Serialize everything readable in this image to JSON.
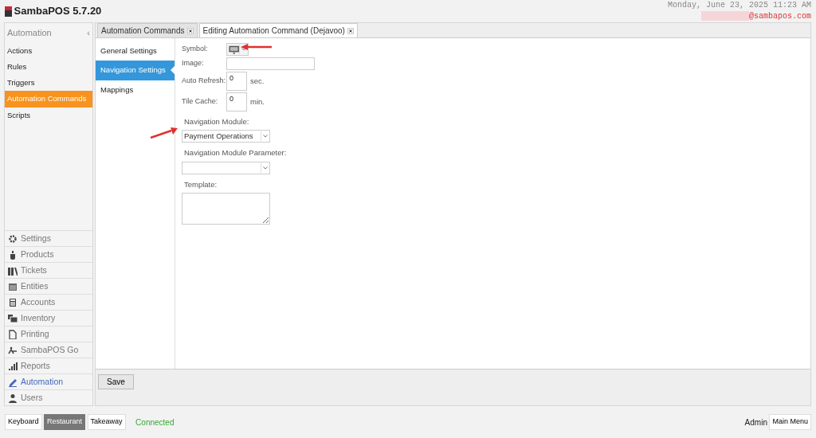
{
  "app": {
    "title": "SambaPOS 5.7.20"
  },
  "header": {
    "datetime": "Monday, June 23, 2025 11:23 AM",
    "email": "@sambapos.com"
  },
  "sidebar": {
    "section_title": "Automation",
    "collapse": "‹",
    "items": [
      {
        "label": "Actions",
        "selected": false
      },
      {
        "label": "Rules",
        "selected": false
      },
      {
        "label": "Triggers",
        "selected": false
      },
      {
        "label": "Automation Commands",
        "selected": true
      },
      {
        "label": "Scripts",
        "selected": false
      }
    ],
    "modules": [
      {
        "label": "Settings",
        "selected": false
      },
      {
        "label": "Products",
        "selected": false
      },
      {
        "label": "Tickets",
        "selected": false
      },
      {
        "label": "Entities",
        "selected": false
      },
      {
        "label": "Accounts",
        "selected": false
      },
      {
        "label": "Inventory",
        "selected": false
      },
      {
        "label": "Printing",
        "selected": false
      },
      {
        "label": "SambaPOS Go",
        "selected": false
      },
      {
        "label": "Reports",
        "selected": false
      },
      {
        "label": "Automation",
        "selected": true
      },
      {
        "label": "Users",
        "selected": false
      }
    ]
  },
  "tabs": [
    {
      "label": "Automation Commands",
      "selected": false
    },
    {
      "label": "Editing Automation Command (Dejavoo)",
      "selected": true
    }
  ],
  "settings_tabs": [
    {
      "label": "General Settings",
      "selected": false
    },
    {
      "label": "Navigation Settings",
      "selected": true
    },
    {
      "label": "Mappings",
      "selected": false
    }
  ],
  "form": {
    "fields": [
      {
        "kind": "symbol",
        "label": "Symbol:"
      },
      {
        "kind": "text",
        "label": "Image:"
      },
      {
        "kind": "number",
        "label": "Auto Refresh:",
        "value": "0",
        "unit": "sec."
      },
      {
        "kind": "number",
        "label": "Tile Cache:",
        "value": "0",
        "unit": "min."
      },
      {
        "kind": "select",
        "label": "Navigation Module:",
        "value": "Payment Operations"
      },
      {
        "kind": "select",
        "label": "Navigation Module Parameter:"
      },
      {
        "kind": "textarea",
        "label": "Template:"
      }
    ]
  },
  "save_button": "Save",
  "status_bar": {
    "departments": [
      {
        "label": "Keyboard",
        "selected": false
      },
      {
        "label": "Restaurant",
        "selected": true
      },
      {
        "label": "Takeaway",
        "selected": false
      }
    ],
    "connection": "Connected",
    "user": "Admin",
    "main_menu": "Main Menu"
  }
}
